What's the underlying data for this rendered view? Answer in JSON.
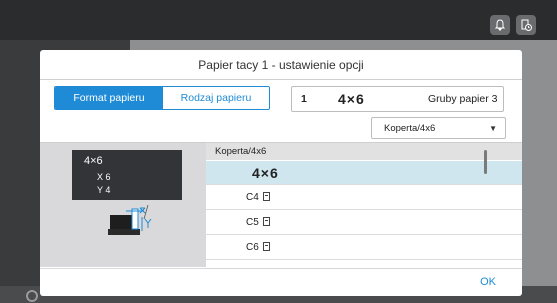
{
  "topbar": {
    "icons": [
      "bell-icon",
      "timer-icon"
    ]
  },
  "dialog": {
    "title": "Papier tacy 1 - ustawienie opcji",
    "tabs": [
      {
        "label": "Format papieru",
        "active": true
      },
      {
        "label": "Rodzaj papieru",
        "active": false
      }
    ],
    "summary": {
      "tray": "1",
      "size": "4×6",
      "type": "Gruby papier 3"
    },
    "select": {
      "value": "Koperta/4x6"
    },
    "illustration": {
      "size": "4×6",
      "x": "X 6",
      "y": "Y 4"
    },
    "list": {
      "header": "Koperta/4x6",
      "items": [
        {
          "label": "4×6",
          "selected": true
        },
        {
          "label": "C4",
          "selected": false
        },
        {
          "label": "C5",
          "selected": false
        },
        {
          "label": "C6",
          "selected": false
        }
      ]
    },
    "ok_label": "OK"
  },
  "colors": {
    "accent": "#1f8bd6",
    "selected_row": "#cfe6ef"
  }
}
